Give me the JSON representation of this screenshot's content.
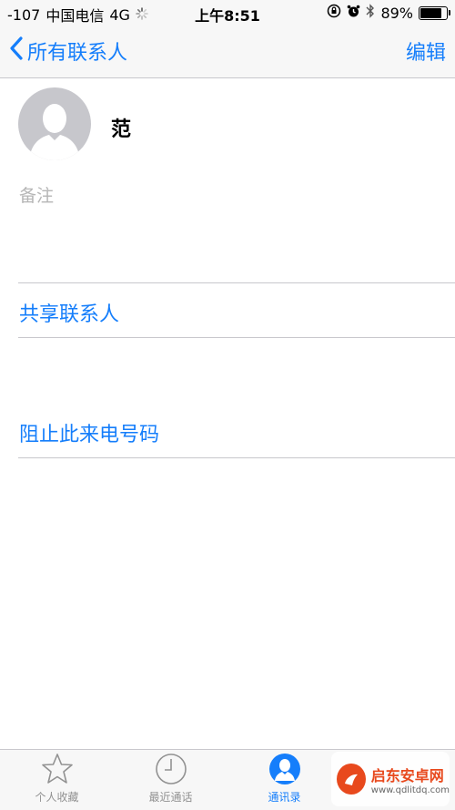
{
  "status_bar": {
    "signal": "-107",
    "carrier": "中国电信",
    "network": "4G",
    "time": "上午8:51",
    "battery_percent": "89%",
    "battery_level": 0.89
  },
  "nav": {
    "back_label": "所有联系人",
    "edit_label": "编辑"
  },
  "contact": {
    "name": "范",
    "notes_label": "备注"
  },
  "actions": {
    "share_contact": "共享联系人",
    "block_caller": "阻止此来电号码"
  },
  "tabs": [
    {
      "label": "个人收藏",
      "icon": "star-icon",
      "active": false
    },
    {
      "label": "最近通话",
      "icon": "clock-icon",
      "active": false
    },
    {
      "label": "通讯录",
      "icon": "contact-icon",
      "active": true
    }
  ],
  "watermark": {
    "title": "启东安卓网",
    "url": "www.qdlitdq.com"
  },
  "colors": {
    "accent": "#157efb",
    "separator": "#c8c7cc",
    "muted": "#929292"
  }
}
